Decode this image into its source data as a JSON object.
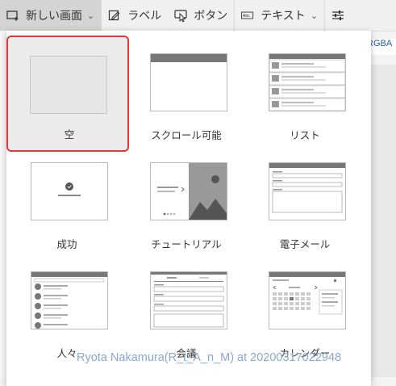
{
  "toolbar": {
    "new_screen_label": "新しい画面",
    "label_label": "ラベル",
    "button_label": "ボタン",
    "text_label": "テキスト",
    "text_icon_text": "Abc"
  },
  "background": {
    "rgba_text": "RGBA"
  },
  "templates": [
    {
      "label": "空"
    },
    {
      "label": "スクロール可能"
    },
    {
      "label": "リスト"
    },
    {
      "label": "成功"
    },
    {
      "label": "チュートリアル"
    },
    {
      "label": "電子メール"
    },
    {
      "label": "人々"
    },
    {
      "label": "会議"
    },
    {
      "label": "カレンダー"
    }
  ],
  "watermark": "Ryota Nakamura(R_t_A_n_M) at 20200317022948",
  "colors": {
    "selection_border": "#e0393e",
    "accent_text": "#1f5fa8"
  }
}
